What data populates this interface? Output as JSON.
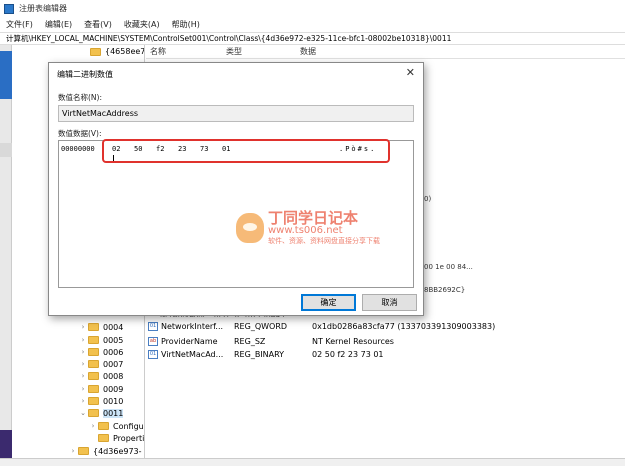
{
  "window": {
    "title": "注册表编辑器"
  },
  "menu": [
    "文件(F)",
    "编辑(E)",
    "查看(V)",
    "收藏夹(A)",
    "帮助(H)"
  ],
  "address": "计算机\\HKEY_LOCAL_MACHINE\\SYSTEM\\ControlSet001\\Control\\Class\\{4d36e972-e325-11ce-bfc1-08002be10318}\\0011",
  "tree": {
    "top_item": "{4658ee7e-",
    "items": [
      "0004",
      "0005",
      "0006",
      "0007",
      "0008",
      "0009",
      "0010",
      "0011",
      "Configur",
      "Properti",
      "{4d36e973-"
    ]
  },
  "list": {
    "headers": {
      "name": "名称",
      "type": "类型",
      "data": "数据"
    },
    "clipped": {
      "a": "0)",
      "b": "00 1e 00 84...",
      "c": "8BB2692C}",
      "d": "NetworkAddr...  REG_SZ            18273BA43"
    },
    "rows": [
      {
        "icon": "bin",
        "name": "NetworkInterf...",
        "type": "REG_QWORD",
        "data": "0x1db0286a83cfa77 (133703391309003383)"
      },
      {
        "icon": "str",
        "name": "ProviderName",
        "type": "REG_SZ",
        "data": "NT Kernel Resources"
      },
      {
        "icon": "bin",
        "name": "VirtNetMacAd...",
        "type": "REG_BINARY",
        "data": "02 50 f2 23 73 01"
      }
    ]
  },
  "dialog": {
    "title": "编辑二进制数值",
    "close": "✕",
    "name_label": "数值名称(N):",
    "name_value": "VirtNetMacAddress",
    "data_label": "数值数据(V):",
    "hex": {
      "address": "00000000",
      "bytes": [
        "02",
        "50",
        "f2",
        "23",
        "73",
        "01"
      ],
      "ascii": ".Pò#s."
    },
    "ok": "确定",
    "cancel": "取消"
  },
  "watermark": {
    "brand": "丁同学日记本",
    "site": "www.ts006.net",
    "tag": "软件、资源、资料网盘直接分享下载"
  },
  "colors": {
    "highlight": "#e0322d",
    "selection": "#cce4f7",
    "folder": "#f2c14e"
  }
}
